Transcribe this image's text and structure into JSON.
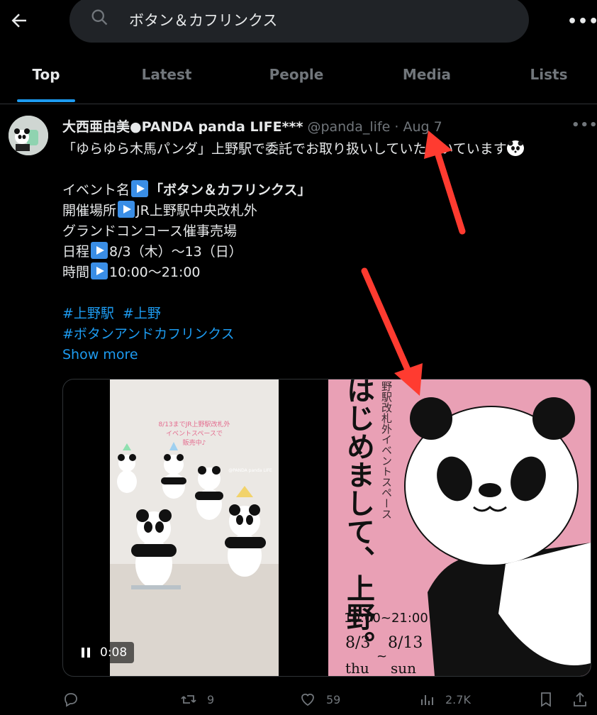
{
  "search": {
    "query": "ボタン＆カフリンクス"
  },
  "tabs": [
    {
      "label": "Top",
      "active": true
    },
    {
      "label": "Latest"
    },
    {
      "label": "People"
    },
    {
      "label": "Media"
    },
    {
      "label": "Lists"
    }
  ],
  "tweet": {
    "display_name": "大西亜由美●PANDA panda LIFE***",
    "handle": "@panda_life",
    "separator": "·",
    "date": "Aug 7",
    "lines": [
      "「ゆらゆら木馬パンダ」上野駅で委託でお取り扱いしていただいています",
      "",
      "イベント名",
      "「ボタン＆カフリンクス」",
      "開催場所",
      "JR上野駅中央改札外",
      "グランドコンコース催事売場",
      "日程",
      "8/3（木）〜13（日）",
      "時間",
      "10:00〜21:00"
    ],
    "hashtags": [
      "#上野駅",
      "#上野",
      "#ボタンアンドカフリンクス"
    ],
    "show_more": "Show more",
    "video": {
      "duration": "0:08",
      "caption_l1": "8/13までJR上野駅改札外",
      "caption_l2": "イベントスペースで",
      "caption_l3": "販売中♪",
      "watermark": "@PANDA panda LIFE"
    },
    "poster": {
      "vertical_small": "野駅改札外イベントスペース",
      "vertical_big": "はじめまして、上野。",
      "time": "10:00~21:00",
      "start_date": "8/3",
      "start_day": "thu",
      "tilde": "~",
      "end_date": "8/13",
      "end_day": "sun"
    },
    "actions": {
      "replies": "",
      "retweets": "9",
      "likes": "59",
      "views": "2.7K"
    }
  },
  "colors": {
    "background": "#000000",
    "accent": "#1d9bf0",
    "muted": "#71767b",
    "arrow": "#ff3b30",
    "poster_pink": "#e9a0b5"
  }
}
